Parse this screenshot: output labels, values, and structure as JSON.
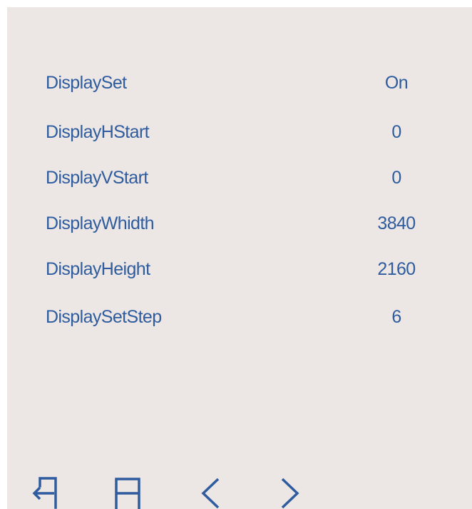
{
  "menu": {
    "rows": [
      {
        "label": "DisplaySet",
        "value": "On"
      },
      {
        "label": "DisplayHStart",
        "value": "0"
      },
      {
        "label": "DisplayVStart",
        "value": "0"
      },
      {
        "label": "DisplayWhidth",
        "value": "3840"
      },
      {
        "label": "DisplayHeight",
        "value": "2160"
      },
      {
        "label": "DisplaySetStep",
        "value": "6"
      }
    ]
  },
  "nav": {
    "icons": [
      "exit-icon",
      "save-icon",
      "chevron-left-icon",
      "chevron-right-icon"
    ]
  },
  "colors": {
    "background": "#ece6e4",
    "text": "#2e5c9e"
  }
}
